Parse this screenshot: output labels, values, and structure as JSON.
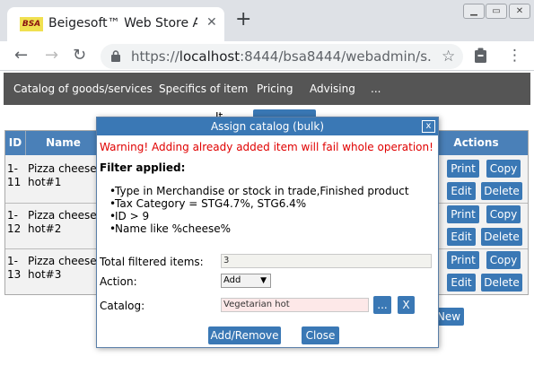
{
  "browser": {
    "tab_title": "Beigesoft™ Web Store Adm",
    "favicon_text": "BSA",
    "url_scheme": "https://",
    "url_host": "localhost",
    "url_rest": ":8444/bsa8444/webadmin/s...",
    "icons": [
      "close-icon",
      "plus-icon",
      "back-arrow-icon",
      "forward-arrow-icon",
      "reload-icon",
      "lock-icon",
      "star-icon",
      "extension-icon",
      "more-menu-icon",
      "minimize-icon",
      "maximize-icon",
      "window-close-icon"
    ]
  },
  "nav": {
    "items": [
      "Catalog of goods/services",
      "Specifics of item",
      "Pricing",
      "Advising",
      "..."
    ]
  },
  "page": {
    "filter_label_partial": "It",
    "new_button": "New"
  },
  "grid": {
    "headers": {
      "id": "ID",
      "name": "Name",
      "actions": "Actions"
    },
    "rows": [
      {
        "id": "1-11",
        "name": "Pizza cheese hot#1"
      },
      {
        "id": "1-12",
        "name": "Pizza cheese hot#2"
      },
      {
        "id": "1-13",
        "name": "Pizza cheese hot#3"
      }
    ],
    "actions": {
      "print": "Print",
      "copy": "Copy",
      "edit": "Edit",
      "delete": "Delete"
    }
  },
  "dialog": {
    "title": "Assign catalog (bulk)",
    "close": "x",
    "warning": "Warning! Adding already added item will fail whole operation!",
    "filter_applied": "Filter applied:",
    "criteria": [
      "Type in Merchandise or stock in trade,Finished product",
      "Tax Category = STG4.7%, STG6.4%",
      "ID > 9",
      "Name like %cheese%"
    ],
    "total_label": "Total filtered items:",
    "total_value": "3",
    "action_label": "Action:",
    "action_value": "Add",
    "catalog_label": "Catalog:",
    "catalog_value": "Vegetarian hot",
    "pick_button": "...",
    "clear_button": "X",
    "submit_button": "Add/Remove",
    "close_button": "Close"
  },
  "colors": {
    "accent": "#3a78b5",
    "nav_bg": "#555555",
    "warning": "#e00000",
    "catalog_field_bg": "#fde8e8"
  }
}
